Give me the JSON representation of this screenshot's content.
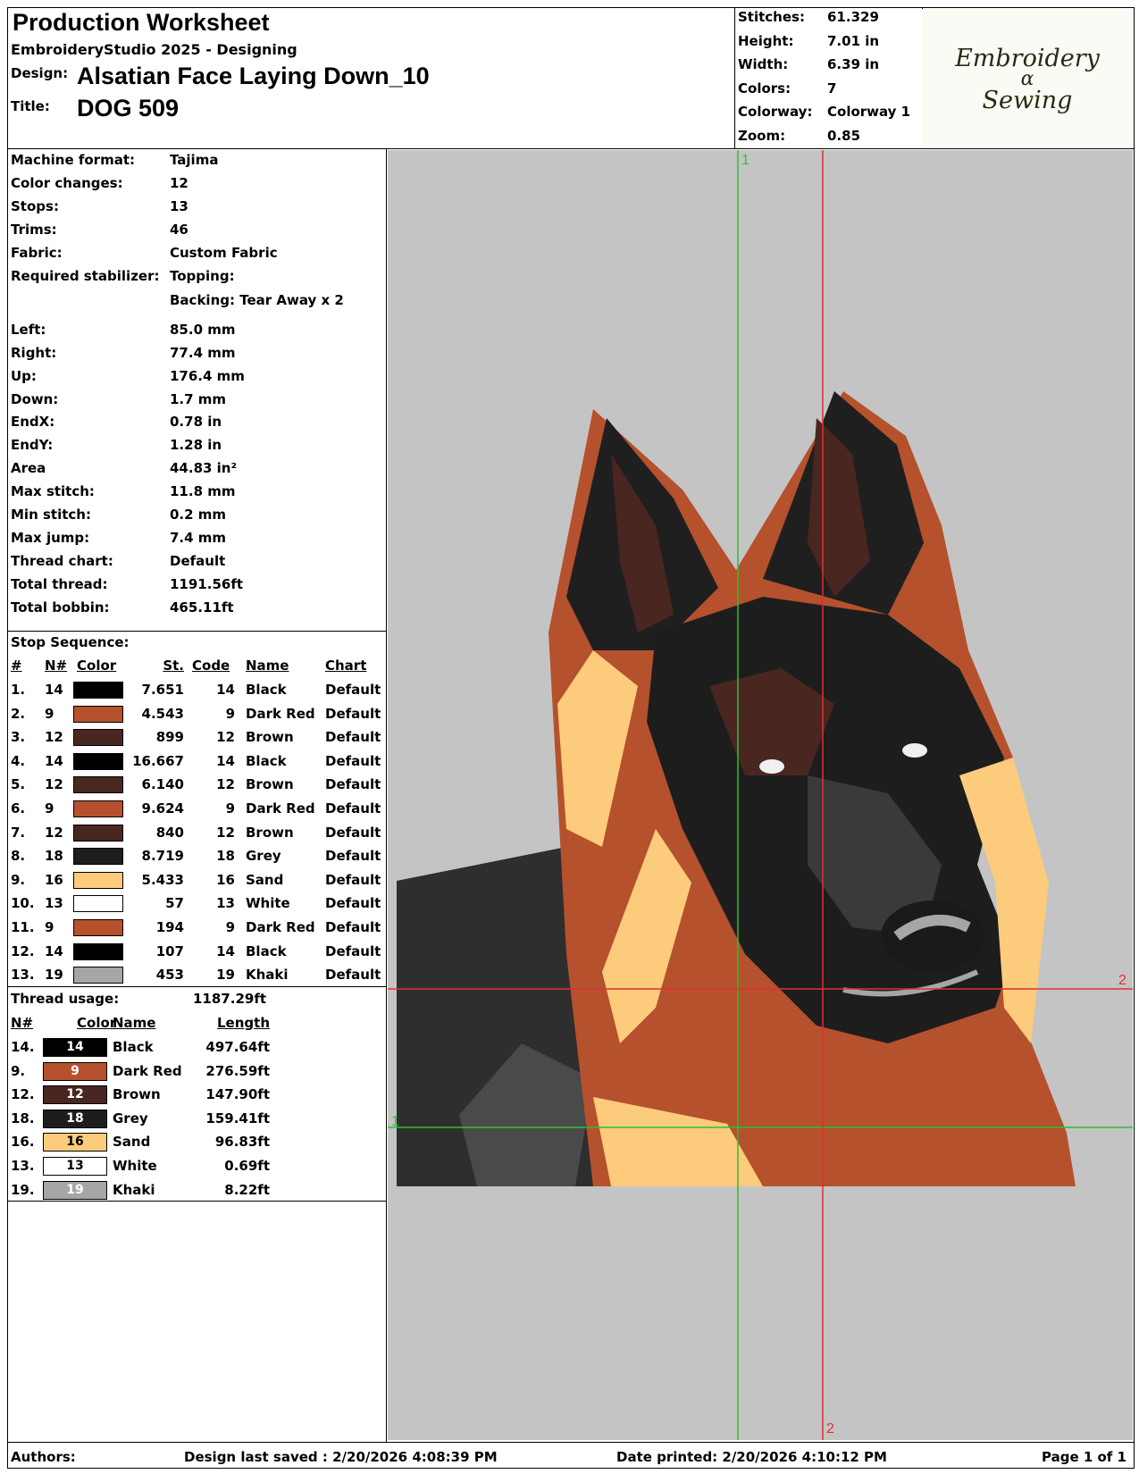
{
  "header": {
    "title": "Production Worksheet",
    "software": "EmbroideryStudio 2025 - Designing",
    "design_label": "Design:",
    "design_value": "Alsatian Face Laying Down_10",
    "title_label": "Title:",
    "title_value": "DOG 509"
  },
  "summary": [
    {
      "label": "Stitches:",
      "value": "61.329"
    },
    {
      "label": "Height:",
      "value": "7.01 in"
    },
    {
      "label": "Width:",
      "value": "6.39 in"
    },
    {
      "label": "Colors:",
      "value": "7"
    },
    {
      "label": "Colorway:",
      "value": "Colorway 1"
    },
    {
      "label": "Zoom:",
      "value": "0.85"
    }
  ],
  "logo": {
    "line1": "Embroidery",
    "line2": "ɑ",
    "line3": "Sewing"
  },
  "details": [
    {
      "label": "Machine format:",
      "value": "Tajima"
    },
    {
      "label": "Color changes:",
      "value": "12"
    },
    {
      "label": "Stops:",
      "value": "13"
    },
    {
      "label": "Trims:",
      "value": "46"
    },
    {
      "label": "Fabric:",
      "value": "Custom Fabric"
    },
    {
      "label": "Required stabilizer:",
      "value": "Topping:"
    },
    {
      "label": "",
      "value": "Backing: Tear Away x 2"
    },
    {
      "label": "Left:",
      "value": "85.0 mm"
    },
    {
      "label": "Right:",
      "value": "77.4 mm"
    },
    {
      "label": "Up:",
      "value": "176.4 mm"
    },
    {
      "label": "Down:",
      "value": "1.7 mm"
    },
    {
      "label": "EndX:",
      "value": "0.78 in"
    },
    {
      "label": "EndY:",
      "value": "1.28 in"
    },
    {
      "label": "Area",
      "value": " 44.83 in²"
    },
    {
      "label": "Max stitch:",
      "value": "11.8 mm"
    },
    {
      "label": "Min stitch:",
      "value": "0.2 mm"
    },
    {
      "label": "Max jump:",
      "value": "7.4 mm"
    },
    {
      "label": "Thread chart:",
      "value": "Default"
    },
    {
      "label": "Total thread:",
      "value": "1191.56ft"
    },
    {
      "label": "Total bobbin:",
      "value": "465.11ft"
    }
  ],
  "stop_sequence": {
    "title": "Stop Sequence:",
    "headers": {
      "num": "#",
      "n": "N#",
      "color": "Color",
      "st": "St.",
      "code": "Code",
      "name": "Name",
      "chart": "Chart"
    },
    "rows": [
      {
        "num": "1.",
        "n": "14",
        "color": "#000000",
        "st": "7.651",
        "code": "14",
        "name": "Black",
        "chart": "Default"
      },
      {
        "num": "2.",
        "n": "9",
        "color": "#b5512c",
        "st": "4.543",
        "code": "9",
        "name": "Dark Red",
        "chart": "Default"
      },
      {
        "num": "3.",
        "n": "12",
        "color": "#4a2621",
        "st": "899",
        "code": "12",
        "name": "Brown",
        "chart": "Default"
      },
      {
        "num": "4.",
        "n": "14",
        "color": "#000000",
        "st": "16.667",
        "code": "14",
        "name": "Black",
        "chart": "Default"
      },
      {
        "num": "5.",
        "n": "12",
        "color": "#4a2621",
        "st": "6.140",
        "code": "12",
        "name": "Brown",
        "chart": "Default"
      },
      {
        "num": "6.",
        "n": "9",
        "color": "#b5512c",
        "st": "9.624",
        "code": "9",
        "name": "Dark Red",
        "chart": "Default"
      },
      {
        "num": "7.",
        "n": "12",
        "color": "#4a2621",
        "st": "840",
        "code": "12",
        "name": "Brown",
        "chart": "Default"
      },
      {
        "num": "8.",
        "n": "18",
        "color": "#1d1d1d",
        "st": "8.719",
        "code": "18",
        "name": "Grey",
        "chart": "Default"
      },
      {
        "num": "9.",
        "n": "16",
        "color": "#fdcb7c",
        "st": "5.433",
        "code": "16",
        "name": "Sand",
        "chart": "Default"
      },
      {
        "num": "10.",
        "n": "13",
        "color": "#ffffff",
        "st": "57",
        "code": "13",
        "name": "White",
        "chart": "Default"
      },
      {
        "num": "11.",
        "n": "9",
        "color": "#b5512c",
        "st": "194",
        "code": "9",
        "name": "Dark Red",
        "chart": "Default"
      },
      {
        "num": "12.",
        "n": "14",
        "color": "#000000",
        "st": "107",
        "code": "14",
        "name": "Black",
        "chart": "Default"
      },
      {
        "num": "13.",
        "n": "19",
        "color": "#a6a6a6",
        "st": "453",
        "code": "19",
        "name": "Khaki",
        "chart": "Default"
      }
    ]
  },
  "thread_usage": {
    "title": "Thread usage:",
    "total": "1187.29ft",
    "headers": {
      "n": "N#",
      "color": "Color",
      "name": "Name",
      "length": "Length"
    },
    "rows": [
      {
        "n": "14.",
        "badge": "14",
        "color": "#000000",
        "text": "#ffffff",
        "name": "Black",
        "length": "497.64ft"
      },
      {
        "n": "9.",
        "badge": "9",
        "color": "#b5512c",
        "text": "#ffffff",
        "name": "Dark Red",
        "length": "276.59ft"
      },
      {
        "n": "12.",
        "badge": "12",
        "color": "#4a2621",
        "text": "#ffffff",
        "name": "Brown",
        "length": "147.90ft"
      },
      {
        "n": "18.",
        "badge": "18",
        "color": "#1d1d1d",
        "text": "#ffffff",
        "name": "Grey",
        "length": "159.41ft"
      },
      {
        "n": "16.",
        "badge": "16",
        "color": "#fdcb7c",
        "text": "#000000",
        "name": "Sand",
        "length": "96.83ft"
      },
      {
        "n": "13.",
        "badge": "13",
        "color": "#ffffff",
        "text": "#000000",
        "name": "White",
        "length": "0.69ft"
      },
      {
        "n": "19.",
        "badge": "19",
        "color": "#a6a6a6",
        "text": "#ffffff",
        "name": "Khaki",
        "length": "8.22ft"
      }
    ]
  },
  "preview": {
    "background": "#c4c4c4",
    "guide_v1_label": "1",
    "guide_h2_label": "2",
    "guide_v2_label": "2",
    "guide_h1_label": "1"
  },
  "footer": {
    "authors": "Authors:",
    "saved": "Design last saved : 2/20/2026 4:08:39 PM",
    "printed": "Date printed: 2/20/2026 4:10:12 PM",
    "page": "Page 1 of 1"
  }
}
